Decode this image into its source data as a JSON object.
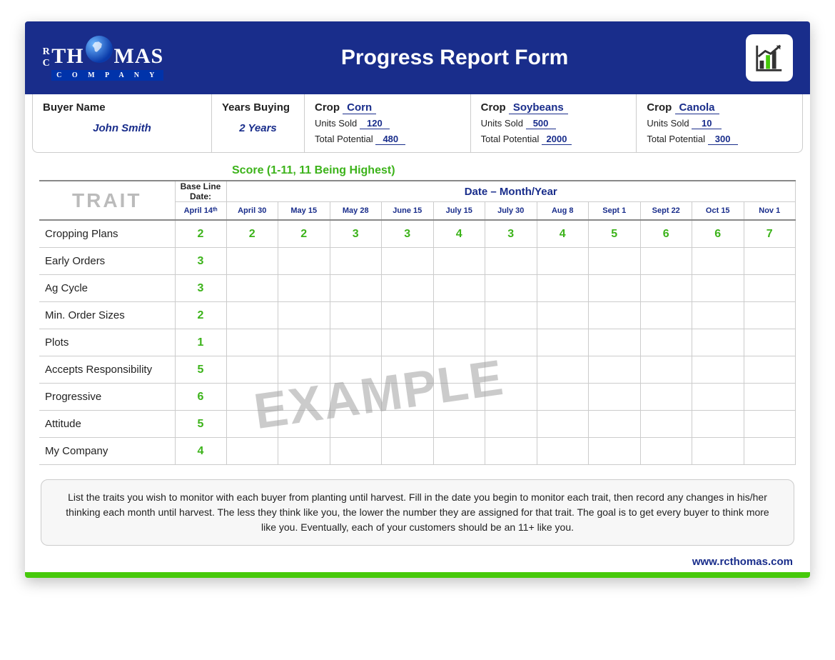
{
  "header": {
    "logo_text1": "TH",
    "logo_text2": "MAS",
    "logo_company": "C O M P A N Y",
    "title": "Progress Report Form"
  },
  "info": {
    "buyer_label": "Buyer Name",
    "buyer_value": "John Smith",
    "years_label": "Years Buying",
    "years_value": "2 Years",
    "crops": [
      {
        "crop_label": "Crop",
        "name": "Corn",
        "units_label": "Units Sold",
        "units": "120",
        "pot_label": "Total Potential",
        "pot": "480"
      },
      {
        "crop_label": "Crop",
        "name": "Soybeans",
        "units_label": "Units Sold",
        "units": "500",
        "pot_label": "Total Potential",
        "pot": "2000"
      },
      {
        "crop_label": "Crop",
        "name": "Canola",
        "units_label": "Units Sold",
        "units": "10",
        "pot_label": "Total Potential",
        "pot": "300"
      }
    ]
  },
  "score_note": "Score (1-11, 11 Being Highest)",
  "table": {
    "trait_head": "TRAIT",
    "baseline_head": "Base Line Date:",
    "baseline_date": "April 14ᵗʰ",
    "date_head": "Date – Month/Year",
    "dates": [
      "April 30",
      "May 15",
      "May 28",
      "June 15",
      "July 15",
      "July 30",
      "Aug 8",
      "Sept 1",
      "Sept 22",
      "Oct 15",
      "Nov 1"
    ],
    "rows": [
      {
        "trait": "Cropping Plans",
        "base": "2",
        "scores": [
          "2",
          "2",
          "3",
          "3",
          "4",
          "3",
          "4",
          "5",
          "6",
          "6",
          "7"
        ]
      },
      {
        "trait": "Early Orders",
        "base": "3",
        "scores": [
          "",
          "",
          "",
          "",
          "",
          "",
          "",
          "",
          "",
          "",
          ""
        ]
      },
      {
        "trait": "Ag Cycle",
        "base": "3",
        "scores": [
          "",
          "",
          "",
          "",
          "",
          "",
          "",
          "",
          "",
          "",
          ""
        ]
      },
      {
        "trait": "Min. Order Sizes",
        "base": "2",
        "scores": [
          "",
          "",
          "",
          "",
          "",
          "",
          "",
          "",
          "",
          "",
          ""
        ]
      },
      {
        "trait": "Plots",
        "base": "1",
        "scores": [
          "",
          "",
          "",
          "",
          "",
          "",
          "",
          "",
          "",
          "",
          ""
        ]
      },
      {
        "trait": "Accepts Responsibility",
        "base": "5",
        "scores": [
          "",
          "",
          "",
          "",
          "",
          "",
          "",
          "",
          "",
          "",
          ""
        ]
      },
      {
        "trait": "Progressive",
        "base": "6",
        "scores": [
          "",
          "",
          "",
          "",
          "",
          "",
          "",
          "",
          "",
          "",
          ""
        ]
      },
      {
        "trait": "Attitude",
        "base": "5",
        "scores": [
          "",
          "",
          "",
          "",
          "",
          "",
          "",
          "",
          "",
          "",
          ""
        ]
      },
      {
        "trait": "My Company",
        "base": "4",
        "scores": [
          "",
          "",
          "",
          "",
          "",
          "",
          "",
          "",
          "",
          "",
          ""
        ]
      }
    ]
  },
  "watermark": "EXAMPLE",
  "note": "List the traits you wish to monitor with each buyer from planting until harvest.  Fill in the date you begin to monitor each trait, then record any changes in his/her thinking each month until harvest.  The less they think like you, the lower the number they are assigned for that trait.  The goal is to get every buyer to think more like you.  Eventually, each of your customers should be an 11+ like you.",
  "url": "www.rcthomas.com"
}
